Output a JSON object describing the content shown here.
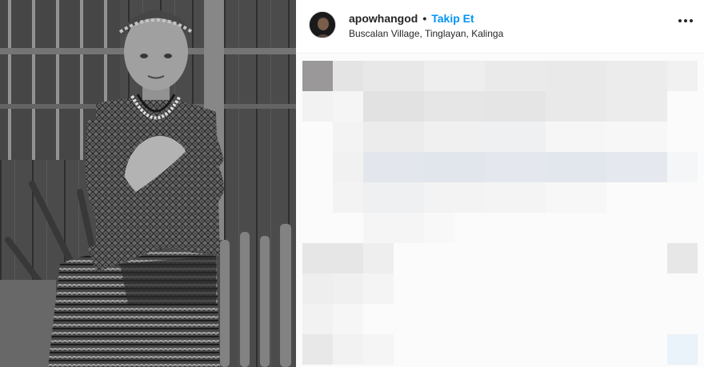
{
  "header": {
    "username": "apowhangod",
    "separator": "•",
    "follow_label": "Takip Et",
    "location": "Buscalan Village, Tinglayan, Kalinga"
  },
  "icons": {
    "more": "more-options-icon"
  },
  "colors": {
    "follow": "#0095f6",
    "text": "#262626",
    "divider": "#efefef"
  }
}
